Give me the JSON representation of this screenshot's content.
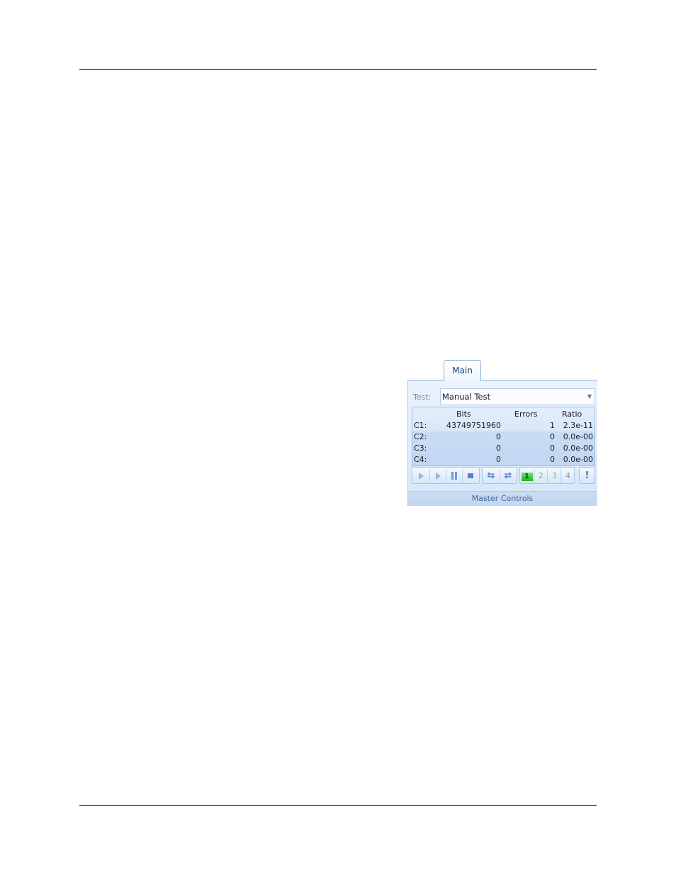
{
  "panel": {
    "tab_label": "Main",
    "test_label": "Test:",
    "test_value": "Manual Test",
    "columns": {
      "bits": "Bits",
      "errors": "Errors",
      "ratio": "Ratio"
    },
    "rows": [
      {
        "label": "C1:",
        "bits": "43749751960",
        "errors": "1",
        "ratio": "2.3e-11"
      },
      {
        "label": "C2:",
        "bits": "0",
        "errors": "0",
        "ratio": "0.0e-00"
      },
      {
        "label": "C3:",
        "bits": "0",
        "errors": "0",
        "ratio": "0.0e-00"
      },
      {
        "label": "C4:",
        "bits": "0",
        "errors": "0",
        "ratio": "0.0e-00"
      }
    ],
    "toolbar": {
      "play_icon": "play-icon",
      "play_loop_icon": "play-loop-icon",
      "pause_icon": "pause-icon",
      "stop_icon": "stop-icon",
      "sync_icon": "sync-icon",
      "sync_all_icon": "sync-all-icon",
      "channels": [
        "1",
        "2",
        "3",
        "4"
      ],
      "active_channel": "1",
      "info_icon": "exclamation-icon"
    },
    "group_label": "Master Controls",
    "accent_color": "#15428b",
    "active_channel_color": "#23b423"
  }
}
